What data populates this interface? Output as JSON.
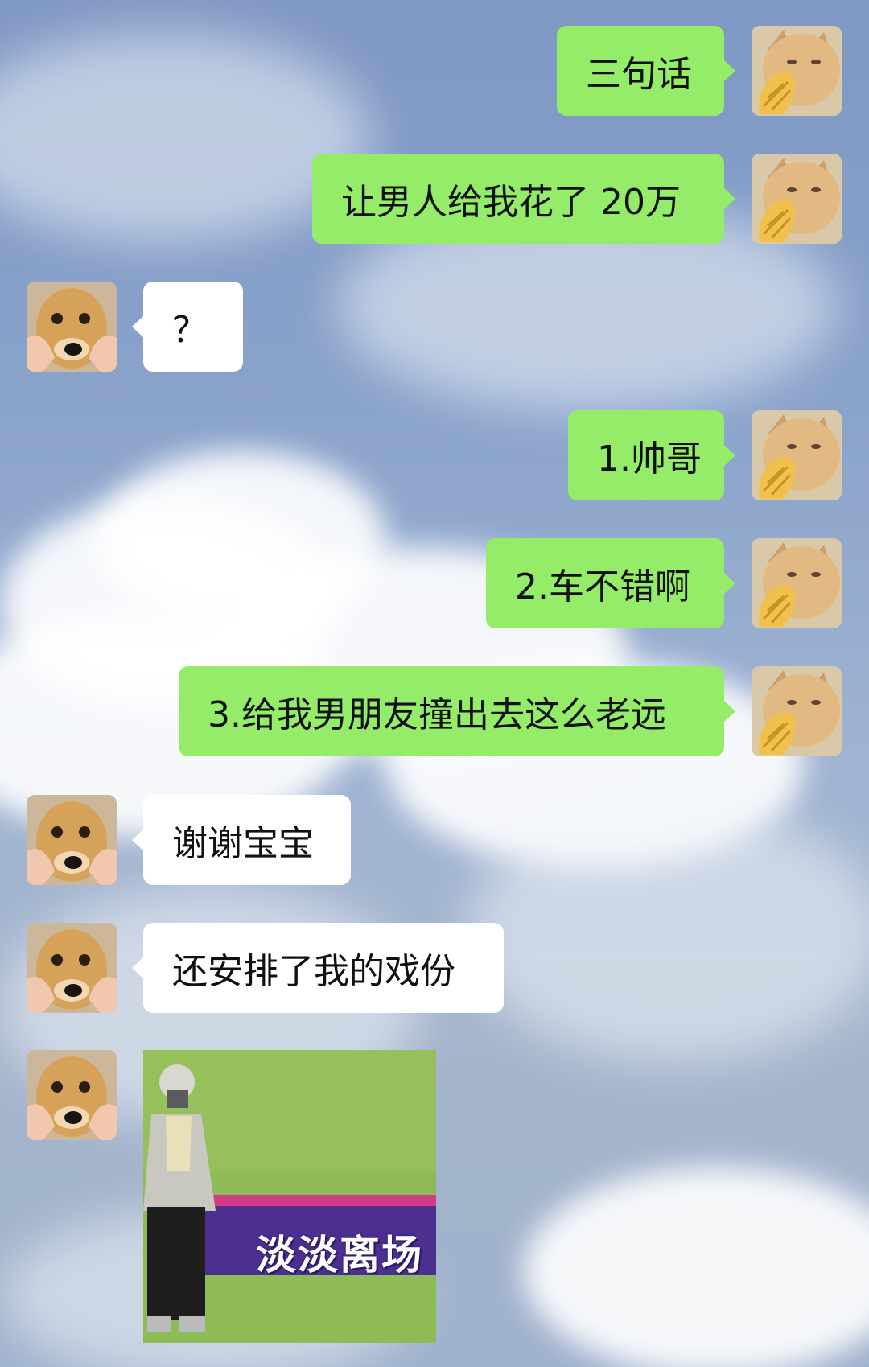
{
  "messages": [
    {
      "side": "right",
      "text": "三句话"
    },
    {
      "side": "right",
      "text": "让男人给我花了 20万"
    },
    {
      "side": "left",
      "text": "？"
    },
    {
      "side": "right",
      "text": "1.帅哥"
    },
    {
      "side": "right",
      "text": "2.车不错啊"
    },
    {
      "side": "right",
      "text": "3.给我男朋友撞出去这么老远"
    },
    {
      "side": "left",
      "text": "谢谢宝宝"
    },
    {
      "side": "left",
      "text": "还安排了我的戏份"
    }
  ],
  "sticker": {
    "caption": "淡淡离场"
  },
  "avatars": {
    "me": "cat-avatar",
    "other": "dog-avatar"
  },
  "colors": {
    "green_bubble": "#95ec69",
    "white_bubble": "#ffffff"
  }
}
